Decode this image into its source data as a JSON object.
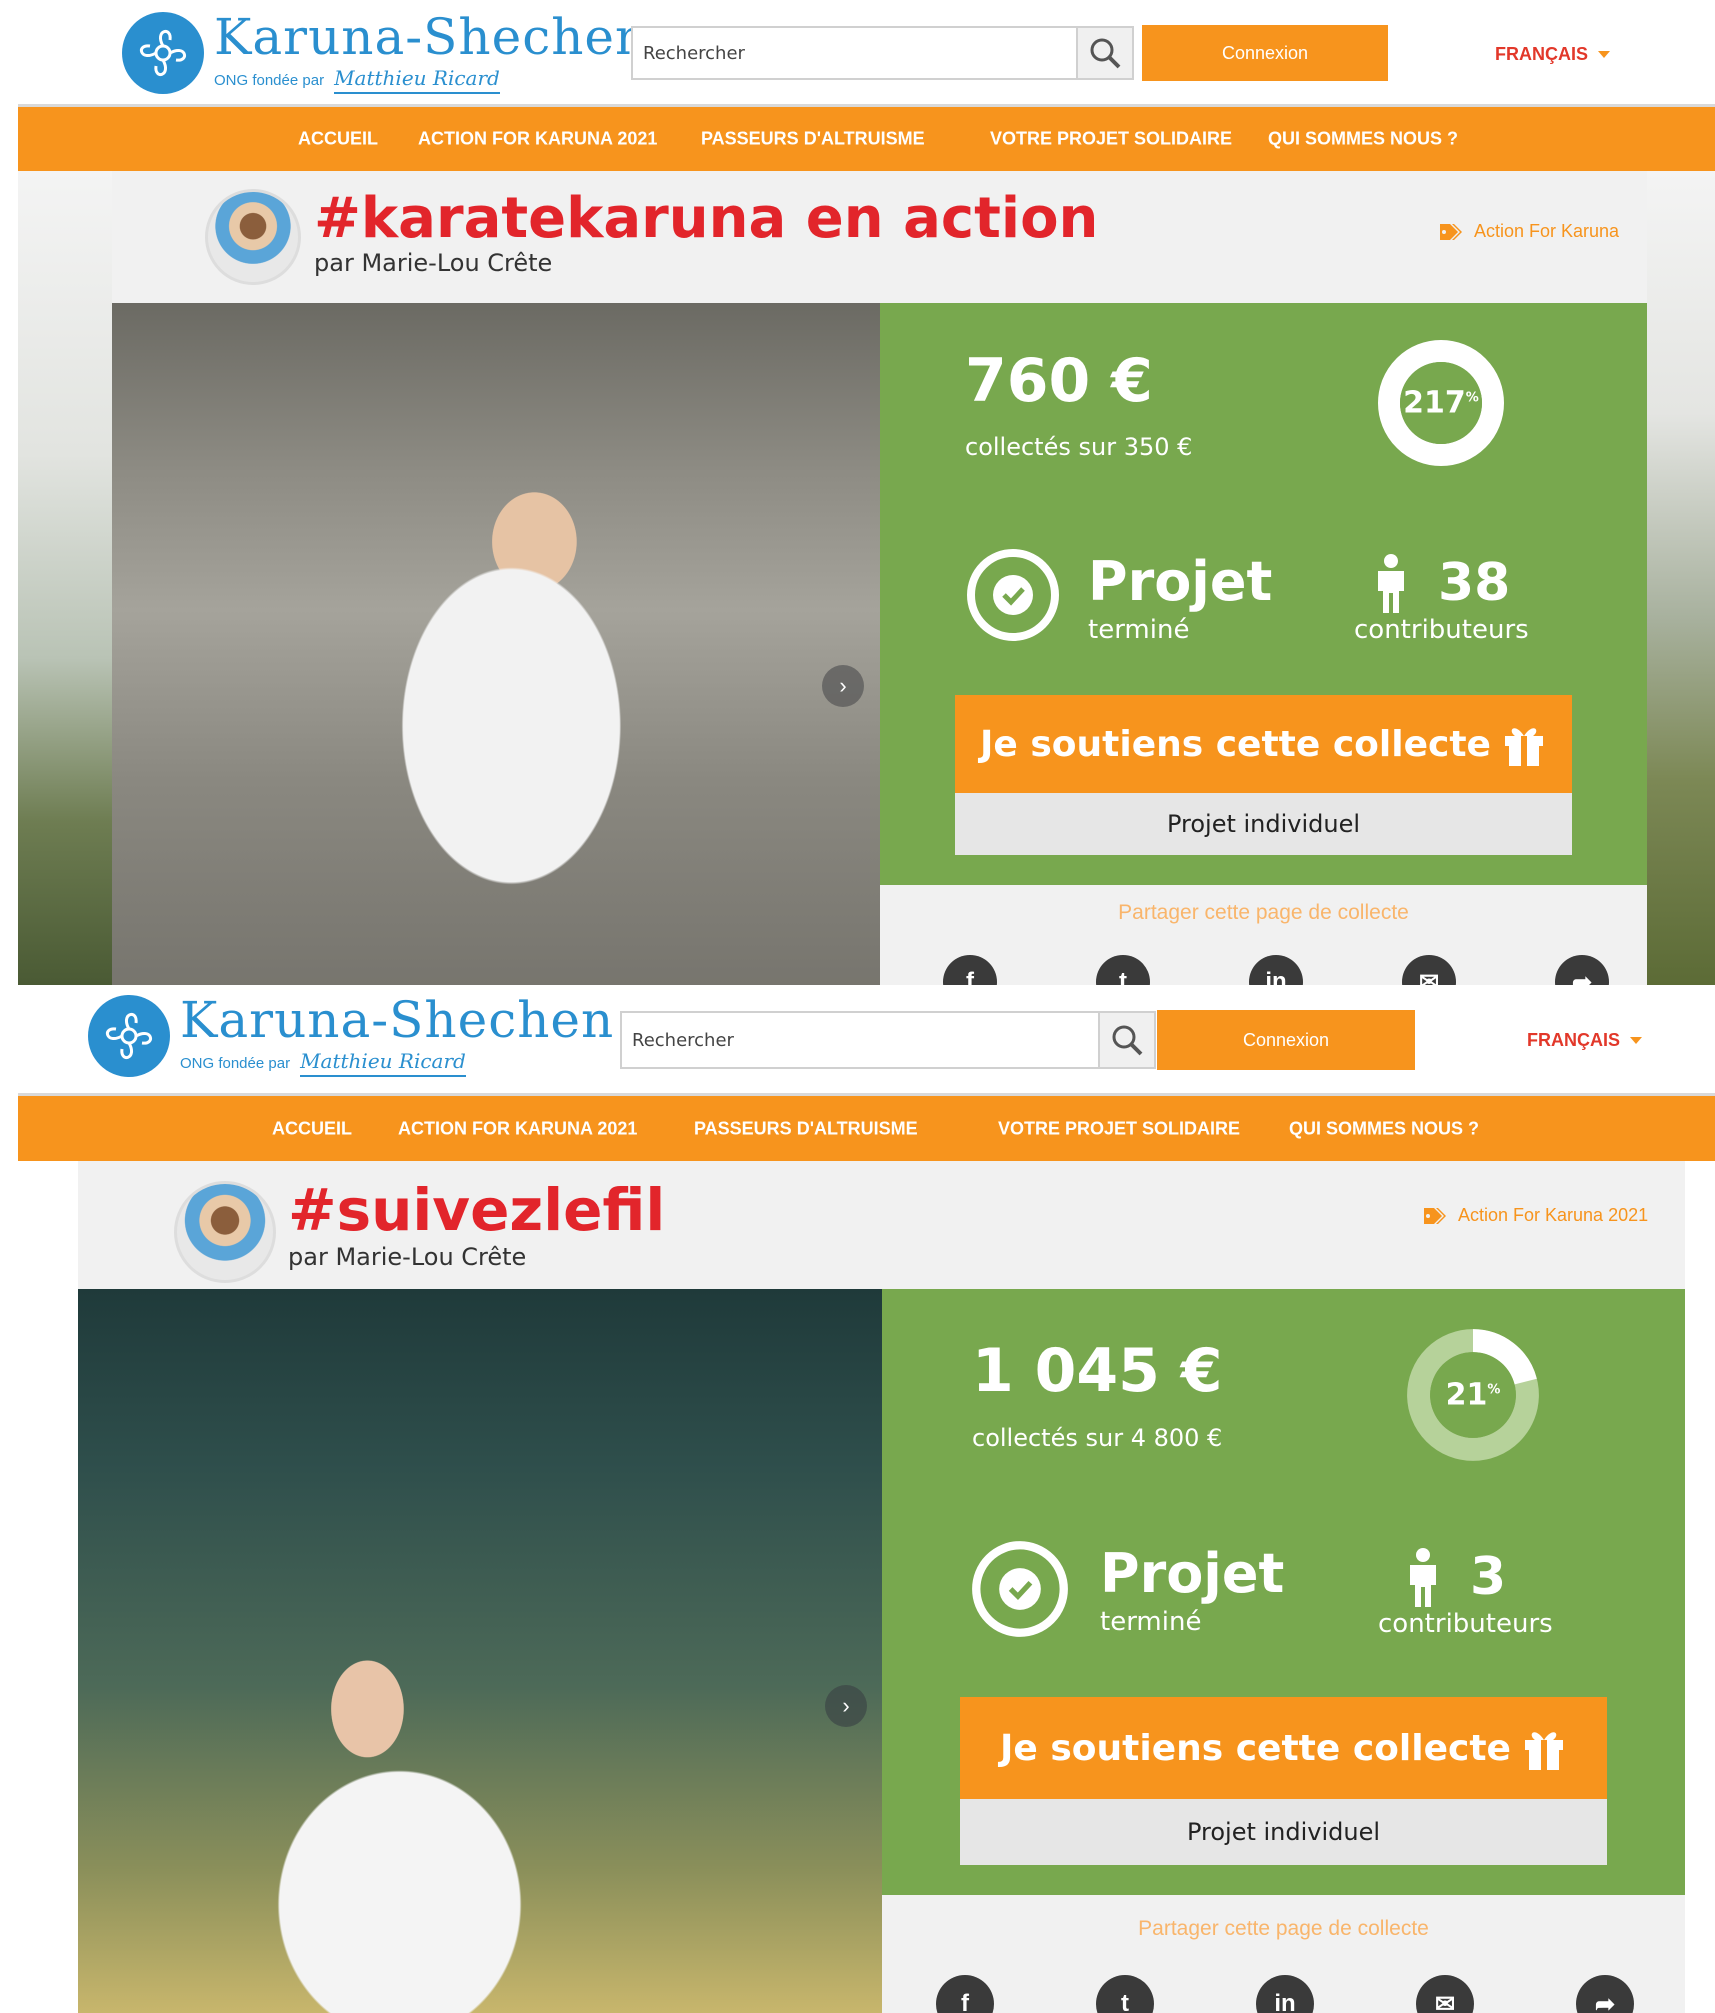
{
  "screens": [
    {
      "header": {
        "brand": "Karuna-Shechen",
        "subtitle": "ONG fondée par",
        "signature": "Matthieu Ricard",
        "search_placeholder": "Rechercher",
        "connexion_label": "Connexion",
        "language": "FRANÇAIS"
      },
      "nav": [
        "ACCUEIL",
        "ACTION FOR KARUNA 2021",
        "PASSEURS D'ALTRUISME",
        "VOTRE PROJET SOLIDAIRE",
        "QUI SOMMES NOUS ?"
      ],
      "campaign": {
        "title": "#karatekaruna en action",
        "author": "par Marie-Lou Crête",
        "tag": "Action For Karuna",
        "amount": "760 €",
        "collected": "collectés sur 350 €",
        "percent": "217",
        "percent_suffix": "%",
        "progress_fraction": 1.0,
        "status_title": "Projet",
        "status_sub": "terminé",
        "contributors": "38",
        "contributors_label": "contributeurs",
        "support_label": "Je soutiens cette collecte",
        "type_label": "Projet individuel",
        "share_label": "Partager cette page de collecte"
      }
    },
    {
      "header": {
        "brand": "Karuna-Shechen",
        "subtitle": "ONG fondée par",
        "signature": "Matthieu Ricard",
        "search_placeholder": "Rechercher",
        "connexion_label": "Connexion",
        "language": "FRANÇAIS"
      },
      "nav": [
        "ACCUEIL",
        "ACTION FOR KARUNA 2021",
        "PASSEURS D'ALTRUISME",
        "VOTRE PROJET SOLIDAIRE",
        "QUI SOMMES NOUS ?"
      ],
      "campaign": {
        "title": "#suivezlefil",
        "author": "par Marie-Lou Crête",
        "tag": "Action For Karuna 2021",
        "amount": "1 045 €",
        "collected": "collectés sur 4 800 €",
        "percent": "21",
        "percent_suffix": "%",
        "progress_fraction": 0.21,
        "status_title": "Projet",
        "status_sub": "terminé",
        "contributors": "3",
        "contributors_label": "contributeurs",
        "support_label": "Je soutiens cette collecte",
        "type_label": "Projet individuel",
        "share_label": "Partager cette page de collecte"
      }
    }
  ],
  "icons": {
    "search": "search-icon",
    "tag": "tag-icon",
    "check": "check-circle-icon",
    "person": "person-icon",
    "gift": "gift-icon",
    "share": [
      "facebook-icon",
      "twitter-icon",
      "linkedin-icon",
      "email-icon",
      "share-icon"
    ]
  },
  "colors": {
    "orange": "#f7941d",
    "green": "#78a84e",
    "red_title": "#e2252b",
    "brand_blue": "#2a8fcf"
  }
}
